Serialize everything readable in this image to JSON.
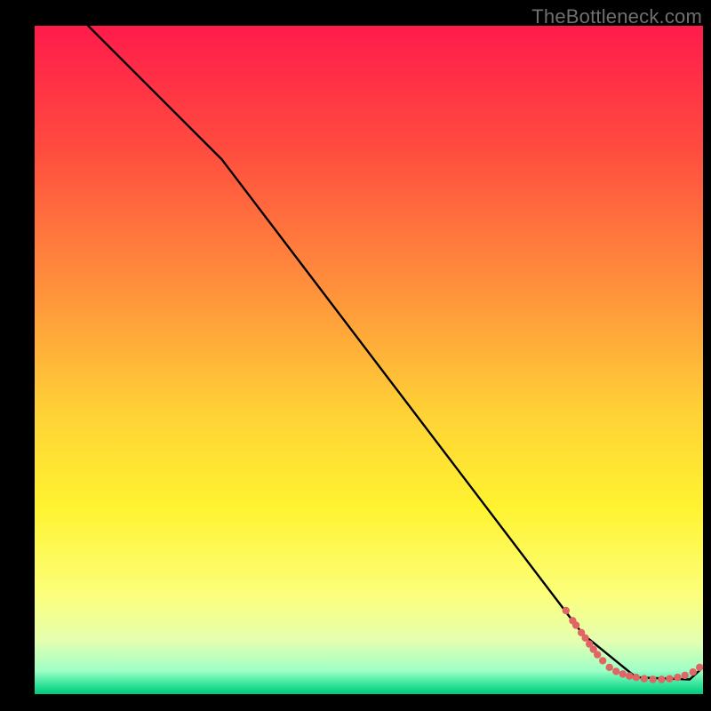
{
  "attribution": "TheBottleneck.com",
  "chart_data": {
    "type": "line",
    "title": "",
    "xlabel": "",
    "ylabel": "",
    "xlim": [
      0,
      100
    ],
    "ylim": [
      0,
      100
    ],
    "gradient_stops": [
      {
        "offset": 0,
        "color": "#ff1b4b"
      },
      {
        "offset": 0.18,
        "color": "#ff4b3f"
      },
      {
        "offset": 0.4,
        "color": "#ff933b"
      },
      {
        "offset": 0.58,
        "color": "#ffd236"
      },
      {
        "offset": 0.72,
        "color": "#fff330"
      },
      {
        "offset": 0.85,
        "color": "#fcff7a"
      },
      {
        "offset": 0.92,
        "color": "#e5ffb0"
      },
      {
        "offset": 0.965,
        "color": "#9effc6"
      },
      {
        "offset": 0.985,
        "color": "#35e59a"
      },
      {
        "offset": 1.0,
        "color": "#00c97c"
      }
    ],
    "series": [
      {
        "name": "bottleneck-curve",
        "x": [
          8,
          28,
          82,
          90,
          98,
          100
        ],
        "y": [
          100,
          80,
          9,
          2.5,
          2.2,
          4
        ]
      }
    ],
    "scatter": {
      "name": "datapoints",
      "color": "#e06666",
      "points": [
        {
          "x": 79.5,
          "y": 12.5
        },
        {
          "x": 80.5,
          "y": 11.0
        },
        {
          "x": 81.0,
          "y": 10.3
        },
        {
          "x": 81.8,
          "y": 9.2
        },
        {
          "x": 82.4,
          "y": 8.4
        },
        {
          "x": 83.0,
          "y": 7.5
        },
        {
          "x": 83.6,
          "y": 6.7
        },
        {
          "x": 84.2,
          "y": 5.9
        },
        {
          "x": 85.0,
          "y": 5.0
        },
        {
          "x": 86.0,
          "y": 4.0
        },
        {
          "x": 87.0,
          "y": 3.4
        },
        {
          "x": 88.0,
          "y": 3.0
        },
        {
          "x": 89.0,
          "y": 2.7
        },
        {
          "x": 90.0,
          "y": 2.5
        },
        {
          "x": 91.2,
          "y": 2.3
        },
        {
          "x": 92.5,
          "y": 2.2
        },
        {
          "x": 93.8,
          "y": 2.2
        },
        {
          "x": 95.0,
          "y": 2.3
        },
        {
          "x": 96.2,
          "y": 2.5
        },
        {
          "x": 97.3,
          "y": 2.8
        },
        {
          "x": 98.5,
          "y": 3.3
        },
        {
          "x": 99.5,
          "y": 4.0
        }
      ]
    }
  }
}
